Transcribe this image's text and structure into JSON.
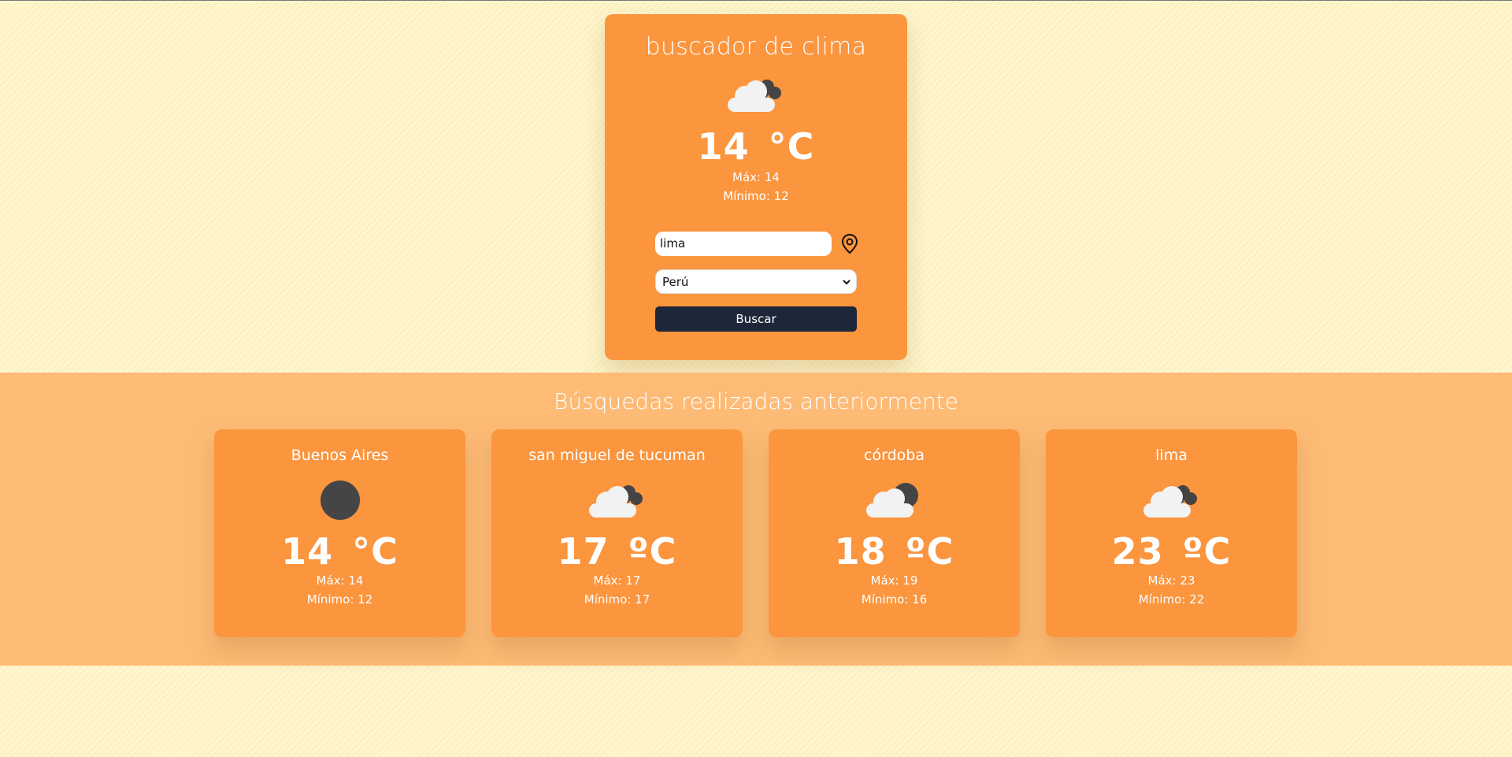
{
  "search_card": {
    "title": "buscador de clima",
    "icon": "cloud-dark-icon",
    "temp": "14",
    "unit": "°C",
    "max": "Máx: 14",
    "min": "Mínimo: 12",
    "city_value": "lima",
    "country_value": "Perú",
    "button_label": "Buscar"
  },
  "history": {
    "title": "Búsquedas realizadas anteriormente",
    "cards": [
      {
        "city": "Buenos Aires",
        "icon": "dark-circle-icon",
        "temp": "14",
        "unit": "°C",
        "max": "Máx: 14",
        "min": "Mínimo: 12"
      },
      {
        "city": "san miguel de tucuman",
        "icon": "cloud-dark-icon",
        "temp": "17",
        "unit": "ºC",
        "max": "Máx: 17",
        "min": "Mínimo: 17"
      },
      {
        "city": "córdoba",
        "icon": "cloud-moon-icon",
        "temp": "18",
        "unit": "ºC",
        "max": "Máx: 19",
        "min": "Mínimo: 16"
      },
      {
        "city": "lima",
        "icon": "cloud-dark-icon",
        "temp": "23",
        "unit": "ºC",
        "max": "Máx: 23",
        "min": "Mínimo: 22"
      }
    ]
  },
  "colors": {
    "card": "#fb953e",
    "history_band": "#fdbb76",
    "button": "#1e2639",
    "background": "#fef6cd"
  }
}
